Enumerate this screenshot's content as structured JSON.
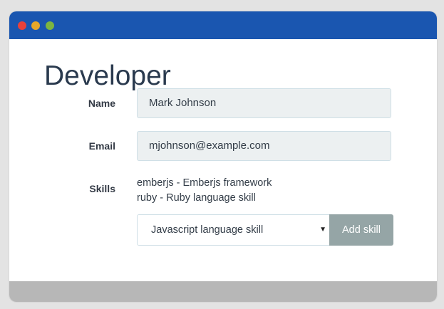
{
  "window": {
    "titlebar_color": "#1a56b0",
    "controls": [
      {
        "name": "close",
        "color": "#e8413a"
      },
      {
        "name": "minimize",
        "color": "#e6a72a"
      },
      {
        "name": "maximize",
        "color": "#7cb541"
      }
    ]
  },
  "page": {
    "title": "Developer"
  },
  "form": {
    "name_label": "Name",
    "name_value": "Mark Johnson",
    "email_label": "Email",
    "email_value": "mjohnson@example.com",
    "skills_label": "Skills",
    "skills": [
      "emberjs - Emberjs framework",
      "ruby - Ruby language skill"
    ],
    "skill_select_value": "Javascript language skill",
    "add_skill_label": "Add skill",
    "add_skill_color": "#95a5a6"
  }
}
